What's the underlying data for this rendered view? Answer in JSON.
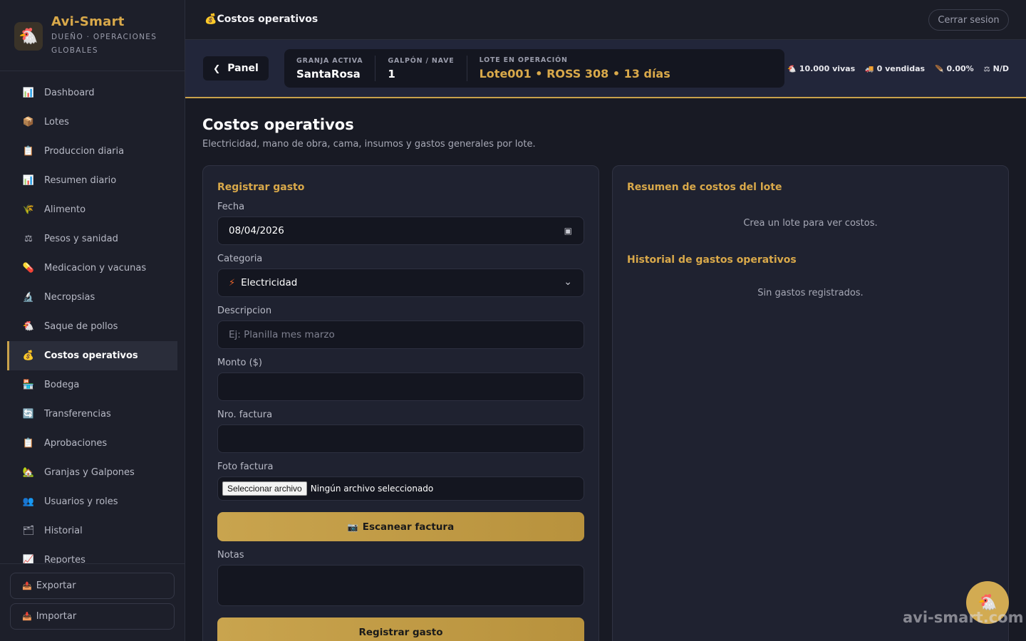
{
  "brand": {
    "name": "Avi-Smart",
    "role_line1": "DUEÑO · OPERACIONES",
    "role_line2": "GLOBALES",
    "logo_icon": "🐔"
  },
  "sidebar": {
    "items": [
      {
        "label": "Dashboard",
        "icon": "📊"
      },
      {
        "label": "Lotes",
        "icon": "📦"
      },
      {
        "label": "Produccion diaria",
        "icon": "📋"
      },
      {
        "label": "Resumen diario",
        "icon": "📊"
      },
      {
        "label": "Alimento",
        "icon": "🌾"
      },
      {
        "label": "Pesos y sanidad",
        "icon": "⚖"
      },
      {
        "label": "Medicacion y vacunas",
        "icon": "💊"
      },
      {
        "label": "Necropsias",
        "icon": "🔬"
      },
      {
        "label": "Saque de pollos",
        "icon": "🐔"
      },
      {
        "label": "Costos operativos",
        "icon": "💰",
        "active": true
      },
      {
        "label": "Bodega",
        "icon": "🏪"
      },
      {
        "label": "Transferencias",
        "icon": "🔄"
      },
      {
        "label": "Aprobaciones",
        "icon": "📋"
      },
      {
        "label": "Granjas y Galpones",
        "icon": "🏡"
      },
      {
        "label": "Usuarios y roles",
        "icon": "👥"
      },
      {
        "label": "Historial",
        "icon": "🗂"
      },
      {
        "label": "Reportes",
        "icon": "📈"
      }
    ],
    "export_label": "Exportar",
    "import_label": "Importar",
    "export_icon": "📤",
    "import_icon": "📥"
  },
  "topbar": {
    "title": "Costos operativos",
    "title_icon": "💰",
    "logout_label": "Cerrar sesion"
  },
  "context": {
    "panel_label": "Panel",
    "granja_label": "GRANJA ACTIVA",
    "granja_value": "SantaRosa",
    "galpon_label": "GALPÓN / NAVE",
    "galpon_value": "1",
    "lote_label": "LOTE EN OPERACIÓN",
    "lote_value": "Lote001 • ROSS 308 • 13 días",
    "stats": [
      {
        "icon": "🐔",
        "text": "10.000 vivas"
      },
      {
        "icon": "🚚",
        "text": "0 vendidas"
      },
      {
        "icon": "🪶",
        "text": "0.00%"
      },
      {
        "icon": "⚖",
        "text": "N/D"
      }
    ]
  },
  "page": {
    "title": "Costos operativos",
    "subtitle": "Electricidad, mano de obra, cama, insumos y gastos generales por lote."
  },
  "form": {
    "title": "Registrar gasto",
    "fecha_label": "Fecha",
    "fecha_value": "08/04/2026",
    "categoria_label": "Categoria",
    "categoria_value": "Electricidad",
    "categoria_icon": "⚡",
    "descripcion_label": "Descripcion",
    "descripcion_placeholder": "Ej: Planilla mes marzo",
    "monto_label": "Monto ($)",
    "factura_label": "Nro. factura",
    "foto_label": "Foto factura",
    "file_button": "Seleccionar archivo",
    "file_status": "Ningún archivo seleccionado",
    "scan_label": "Escanear factura",
    "scan_icon": "📷",
    "notas_label": "Notas",
    "submit_label": "Registrar gasto"
  },
  "summary": {
    "title": "Resumen de costos del lote",
    "empty": "Crea un lote para ver costos.",
    "history_title": "Historial de gastos operativos",
    "history_empty": "Sin gastos registrados."
  },
  "fab_icon": "🐔",
  "watermark": "avi-smart.com",
  "colors": {
    "accent": "#c9a24b",
    "bg": "#181a24",
    "panel": "#1f2230"
  }
}
